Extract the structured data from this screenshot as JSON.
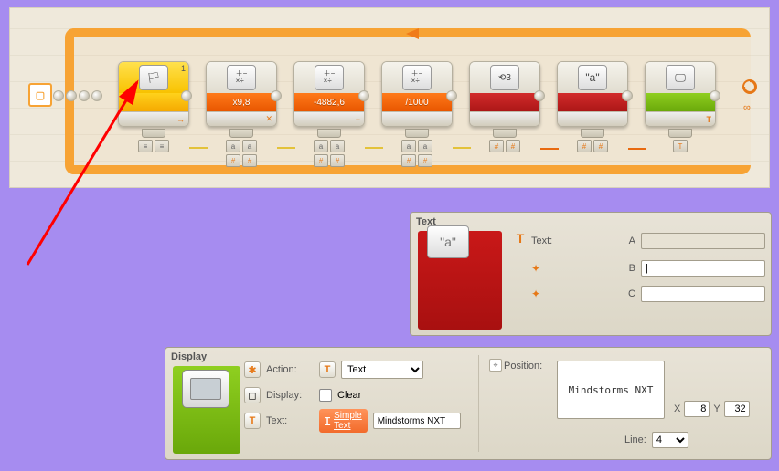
{
  "diagram": {
    "blocks": [
      {
        "kind": "sensor",
        "corner": "1",
        "label": "",
        "badge": "→",
        "color": "yellow",
        "icon": "⚑"
      },
      {
        "kind": "math",
        "label": "x9,8",
        "badge": "✕",
        "color": "orange",
        "icon": "＋−×÷"
      },
      {
        "kind": "math",
        "label": "-4882,6",
        "badge": "−",
        "color": "orange",
        "icon": "＋−×÷"
      },
      {
        "kind": "math",
        "label": "/1000",
        "badge": "",
        "color": "orange",
        "icon": "＋−×÷"
      },
      {
        "kind": "numtotext",
        "label": "",
        "badge": "",
        "color": "red",
        "icon": "⟲3"
      },
      {
        "kind": "text",
        "label": "",
        "badge": "",
        "color": "red",
        "icon": "\"a\""
      },
      {
        "kind": "display",
        "label": "",
        "badge": "T",
        "color": "green",
        "icon": "▭"
      }
    ]
  },
  "text_panel": {
    "title": "Text",
    "text_label": "Text:",
    "rows": [
      "A",
      "B",
      "C"
    ],
    "values": {
      "A": "",
      "B": "|",
      "C": ""
    },
    "icon": "\"a\""
  },
  "display_panel": {
    "title": "Display",
    "action_label": "Action:",
    "action_value": "Text",
    "display_label": "Display:",
    "clear_label": "Clear",
    "clear_checked": false,
    "text_label": "Text:",
    "simple_label_1": "Simple",
    "simple_label_2": "Text",
    "text_value": "Mindstorms NXT",
    "position_label": "Position:",
    "preview_text": "Mindstorms NXT",
    "x_label": "X",
    "x_value": "8",
    "y_label": "Y",
    "y_value": "32",
    "line_label": "Line:",
    "line_value": "4"
  }
}
